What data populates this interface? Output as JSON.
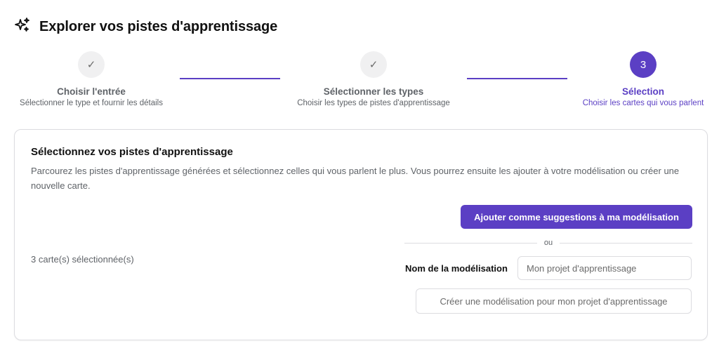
{
  "header": {
    "title": "Explorer vos pistes d'apprentissage",
    "icon": "sparkles-icon"
  },
  "stepper": {
    "steps": [
      {
        "label": "Choisir l'entrée",
        "description": "Sélectionner le type et fournir les détails",
        "status": "done",
        "marker": "✓"
      },
      {
        "label": "Sélectionner les types",
        "description": "Choisir les types de pistes d'apprentissage",
        "status": "done",
        "marker": "✓"
      },
      {
        "label": "Sélection",
        "description": "Choisir les cartes qui vous parlent",
        "status": "active",
        "marker": "3"
      }
    ],
    "accent_color": "#5b3fc4"
  },
  "card": {
    "title": "Sélectionnez vos pistes d'apprentissage",
    "description": "Parcourez les pistes d'apprentissage générées et sélectionnez celles qui vous parlent le plus. Vous pourrez ensuite les ajouter à votre modélisation ou créer une nouvelle carte.",
    "selected_count": "3 carte(s) sélectionnée(s)",
    "add_button_label": "Ajouter comme suggestions à ma modélisation",
    "or_label": "ou",
    "name_label": "Nom de la modélisation",
    "name_input": {
      "value": "",
      "placeholder": "Mon projet d'apprentissage"
    },
    "create_button_label": "Créer une modélisation pour mon projet d'apprentissage"
  }
}
